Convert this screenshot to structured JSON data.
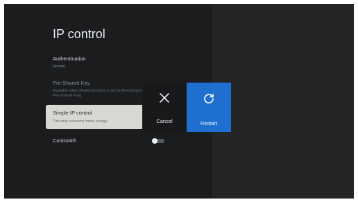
{
  "page_title": "IP control",
  "settings": {
    "authentication": {
      "title": "Authentication",
      "value": "Normal"
    },
    "pre_shared_key": {
      "title": "Pre-Shared Key",
      "description": "Available when [Authentication] is set to [Normal and Pre-Shared Key]."
    },
    "simple_ip_control": {
      "title": "Simple IP control",
      "description": "This may consume more energy."
    },
    "control4": {
      "title": "Control4®",
      "enabled": false
    }
  },
  "actions": {
    "cancel": {
      "label": "Cancel",
      "icon": "close-icon"
    },
    "restart": {
      "label": "Restart",
      "icon": "refresh-icon"
    }
  },
  "colors": {
    "background": "#1a1c1e",
    "panel": "#232527",
    "focus_card": "#d9d7d1",
    "accent": "#1f6fd1"
  }
}
